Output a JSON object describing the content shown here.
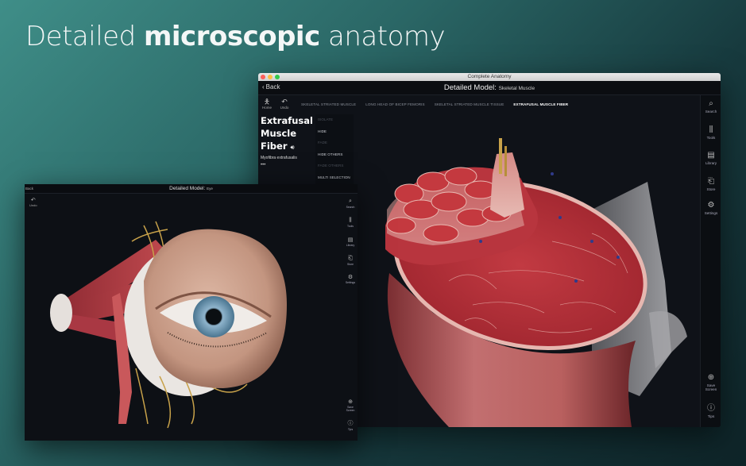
{
  "headline": {
    "regular": "Detailed ",
    "bold": "microscopic",
    "rest": " anatomy"
  },
  "main_window": {
    "window_title": "Complete Anatomy",
    "back_label": "Back",
    "nav_title": "Detailed Model:",
    "nav_subtitle": "Skeletal Muscle",
    "toolbar": {
      "home_label": "Home",
      "undo_label": "Undo"
    },
    "breadcrumbs": [
      {
        "label": "SKELETAL STRIATED MUSCLE",
        "active": false
      },
      {
        "label": "LONG HEAD OF BICEP FEMORIS",
        "active": false
      },
      {
        "label": "SKELETAL STRIATED MUSCLE TISSUE",
        "active": false
      },
      {
        "label": "EXTRAFUSAL MUSCLE FIBER",
        "active": true
      }
    ],
    "structure": {
      "title_line1": "Extrafusal",
      "title_line2": "Muscle",
      "title_line3": "Fiber",
      "latin": "Myofibra extrafusalis",
      "more": "•••"
    },
    "context_menu": [
      {
        "label": "ISOLATE",
        "enabled": false
      },
      {
        "label": "HIDE",
        "enabled": true
      },
      {
        "label": "FADE",
        "enabled": false
      },
      {
        "label": "HIDE OTHERS",
        "enabled": true
      },
      {
        "label": "FADE OTHERS",
        "enabled": false
      },
      {
        "label": "MULTI SELECTION",
        "enabled": true
      }
    ],
    "side": {
      "search": "Search",
      "tools": "Tools",
      "library": "Library",
      "store": "Store",
      "settings": "Settings",
      "save_screen_1": "Save",
      "save_screen_2": "Screen",
      "tips": "Tips"
    }
  },
  "eye_window": {
    "back_label": "Back",
    "nav_title": "Detailed Model:",
    "nav_subtitle": "Eye",
    "undo_label": "Undo",
    "side": {
      "search": "Search",
      "tools": "Tools",
      "library": "Library",
      "store": "Store",
      "settings": "Settings",
      "save_screen_1": "Save",
      "save_screen_2": "Screen",
      "tips": "Tips"
    }
  },
  "colors": {
    "muscle_red": "#b3303a",
    "muscle_pink": "#d48a86",
    "nerve_yellow": "#c8a24a",
    "skin": "#c9a08c",
    "iris": "#6b93ad",
    "app_bg": "#0f1218"
  }
}
